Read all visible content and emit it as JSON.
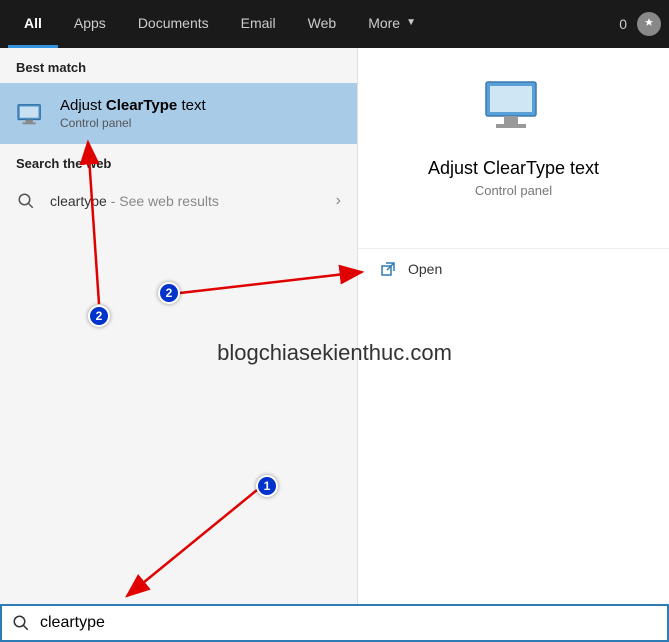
{
  "topbar": {
    "tabs": {
      "all": "All",
      "apps": "Apps",
      "documents": "Documents",
      "email": "Email",
      "web": "Web",
      "more": "More"
    },
    "count": "0"
  },
  "left": {
    "best_match_header": "Best match",
    "result": {
      "title_pre": "Adjust ",
      "title_bold": "ClearType",
      "title_post": " text",
      "subtitle": "Control panel"
    },
    "web_header": "Search the web",
    "web_result": {
      "query": "cleartype",
      "suffix": " - See web results"
    }
  },
  "right": {
    "title": "Adjust ClearType text",
    "subtitle": "Control panel",
    "actions": {
      "open": "Open"
    }
  },
  "search": {
    "value": "cleartype"
  },
  "annotations": {
    "badge1": "1",
    "badge2a": "2",
    "badge2b": "2"
  },
  "watermark": "blogchiasekienthuc.com"
}
